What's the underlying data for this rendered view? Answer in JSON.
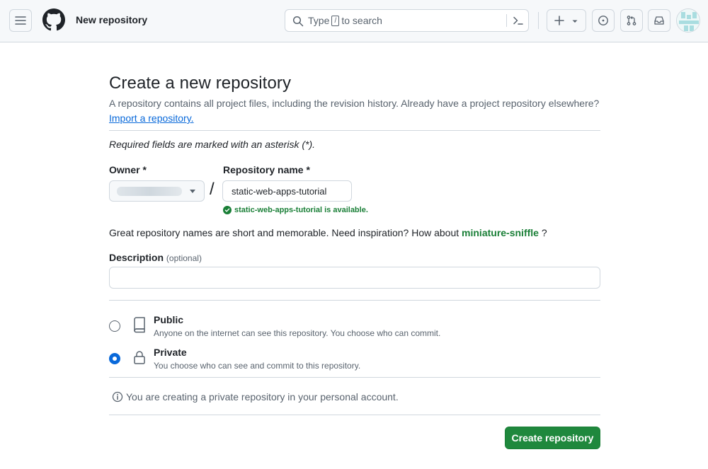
{
  "header": {
    "context_title": "New repository",
    "search": {
      "placeholder_pre": "Type",
      "kbd": "/",
      "placeholder_post": "to search"
    },
    "icons": [
      "menu-icon",
      "github-logo",
      "search-icon",
      "command-palette-icon",
      "plus-icon",
      "triangle-down-icon",
      "issues-icon",
      "pull-requests-icon",
      "inbox-icon",
      "avatar"
    ]
  },
  "page": {
    "title": "Create a new repository",
    "subtitle": "A repository contains all project files, including the revision history. Already have a project repository elsewhere?",
    "import_link": "Import a repository.",
    "required_note": "Required fields are marked with an asterisk (*)."
  },
  "form": {
    "owner_label": "Owner *",
    "slash": "/",
    "repo_label": "Repository name *",
    "repo_value": "static-web-apps-tutorial",
    "availability": "static-web-apps-tutorial is available.",
    "inspiration_text": "Great repository names are short and memorable. Need inspiration? How about",
    "inspiration_suggestion": "miniature-sniffle",
    "inspiration_end": "?",
    "description_label": "Description",
    "description_optional": "(optional)",
    "description_value": ""
  },
  "visibility": {
    "selected": "Private",
    "options": [
      {
        "title": "Public",
        "description": "Anyone on the internet can see this repository. You choose who can commit.",
        "icon": "repo-icon"
      },
      {
        "title": "Private",
        "description": "You choose who can see and commit to this repository.",
        "icon": "lock-icon"
      }
    ]
  },
  "info_message": "You are creating a private repository in your personal account.",
  "submit_label": "Create repository",
  "colors": {
    "primary_button": "#1f883d",
    "link": "#0969da",
    "success": "#1a7f37",
    "radio_checked": "#0969da"
  }
}
